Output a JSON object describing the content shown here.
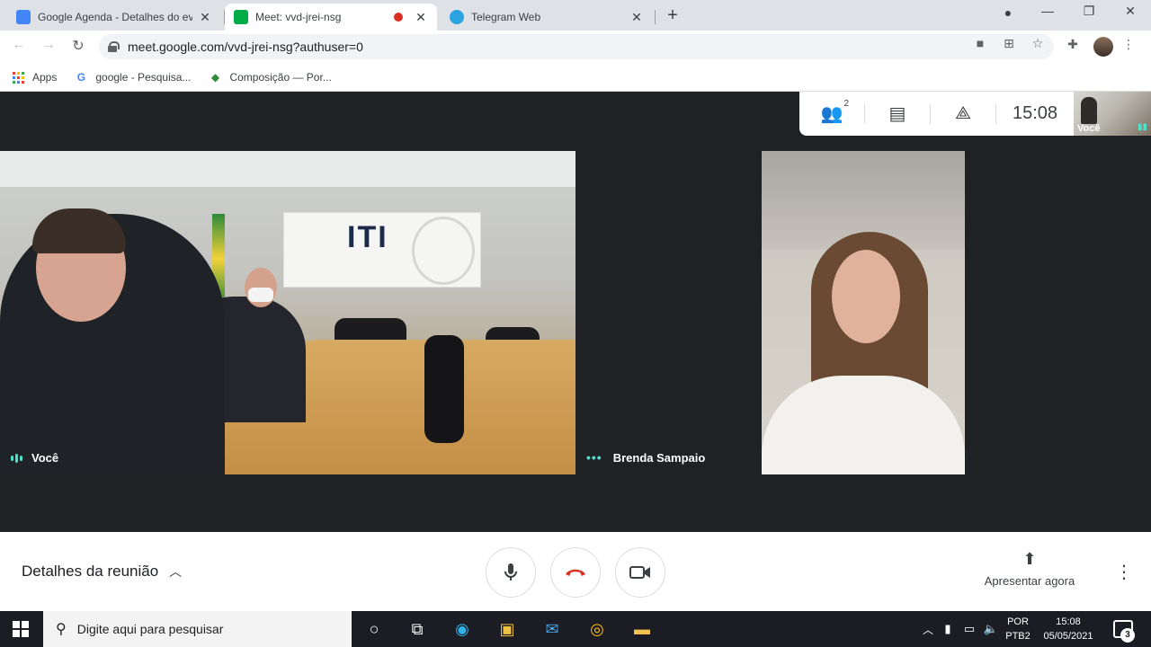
{
  "browser": {
    "tabs": [
      {
        "title": "Google Agenda - Detalhes do ev",
        "favicon_color": "#4285f4",
        "active": false
      },
      {
        "title": "Meet: vvd-jrei-nsg",
        "favicon_color": "#00ac47",
        "active": true
      },
      {
        "title": "Telegram Web",
        "favicon_color": "#2aa3e0",
        "active": false
      }
    ],
    "new_tab_label": "+",
    "address_url": "meet.google.com/vvd-jrei-nsg?authuser=0",
    "bookmarks": [
      {
        "label": "Apps"
      },
      {
        "label": "google - Pesquisa..."
      },
      {
        "label": "Composição — Por..."
      }
    ]
  },
  "meet": {
    "participants_count": "2",
    "clock": "15:08",
    "self_view_label": "Você",
    "tiles": [
      {
        "name": "Você"
      },
      {
        "name": "Brenda Sampaio"
      }
    ],
    "meeting_details_label": "Detalhes da reunião",
    "present_label": "Apresentar agora",
    "accent_color": "#4ee0c8",
    "end_call_color": "#d93025"
  },
  "taskbar": {
    "search_placeholder": "Digite aqui para pesquisar",
    "language_top": "POR",
    "language_bottom": "PTB2",
    "time": "15:08",
    "date": "05/05/2021",
    "notification_count": "3"
  }
}
